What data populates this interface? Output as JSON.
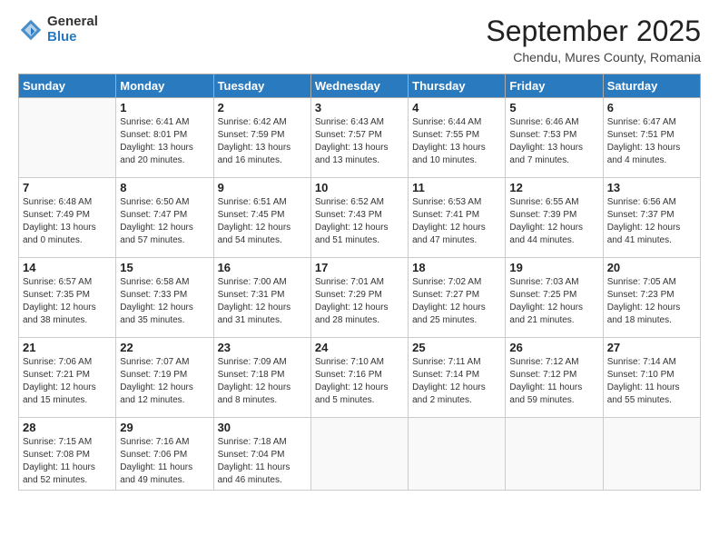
{
  "logo": {
    "general": "General",
    "blue": "Blue"
  },
  "title": "September 2025",
  "location": "Chendu, Mures County, Romania",
  "days_of_week": [
    "Sunday",
    "Monday",
    "Tuesday",
    "Wednesday",
    "Thursday",
    "Friday",
    "Saturday"
  ],
  "weeks": [
    [
      {
        "day": "",
        "info": ""
      },
      {
        "day": "1",
        "info": "Sunrise: 6:41 AM\nSunset: 8:01 PM\nDaylight: 13 hours\nand 20 minutes."
      },
      {
        "day": "2",
        "info": "Sunrise: 6:42 AM\nSunset: 7:59 PM\nDaylight: 13 hours\nand 16 minutes."
      },
      {
        "day": "3",
        "info": "Sunrise: 6:43 AM\nSunset: 7:57 PM\nDaylight: 13 hours\nand 13 minutes."
      },
      {
        "day": "4",
        "info": "Sunrise: 6:44 AM\nSunset: 7:55 PM\nDaylight: 13 hours\nand 10 minutes."
      },
      {
        "day": "5",
        "info": "Sunrise: 6:46 AM\nSunset: 7:53 PM\nDaylight: 13 hours\nand 7 minutes."
      },
      {
        "day": "6",
        "info": "Sunrise: 6:47 AM\nSunset: 7:51 PM\nDaylight: 13 hours\nand 4 minutes."
      }
    ],
    [
      {
        "day": "7",
        "info": "Sunrise: 6:48 AM\nSunset: 7:49 PM\nDaylight: 13 hours\nand 0 minutes."
      },
      {
        "day": "8",
        "info": "Sunrise: 6:50 AM\nSunset: 7:47 PM\nDaylight: 12 hours\nand 57 minutes."
      },
      {
        "day": "9",
        "info": "Sunrise: 6:51 AM\nSunset: 7:45 PM\nDaylight: 12 hours\nand 54 minutes."
      },
      {
        "day": "10",
        "info": "Sunrise: 6:52 AM\nSunset: 7:43 PM\nDaylight: 12 hours\nand 51 minutes."
      },
      {
        "day": "11",
        "info": "Sunrise: 6:53 AM\nSunset: 7:41 PM\nDaylight: 12 hours\nand 47 minutes."
      },
      {
        "day": "12",
        "info": "Sunrise: 6:55 AM\nSunset: 7:39 PM\nDaylight: 12 hours\nand 44 minutes."
      },
      {
        "day": "13",
        "info": "Sunrise: 6:56 AM\nSunset: 7:37 PM\nDaylight: 12 hours\nand 41 minutes."
      }
    ],
    [
      {
        "day": "14",
        "info": "Sunrise: 6:57 AM\nSunset: 7:35 PM\nDaylight: 12 hours\nand 38 minutes."
      },
      {
        "day": "15",
        "info": "Sunrise: 6:58 AM\nSunset: 7:33 PM\nDaylight: 12 hours\nand 35 minutes."
      },
      {
        "day": "16",
        "info": "Sunrise: 7:00 AM\nSunset: 7:31 PM\nDaylight: 12 hours\nand 31 minutes."
      },
      {
        "day": "17",
        "info": "Sunrise: 7:01 AM\nSunset: 7:29 PM\nDaylight: 12 hours\nand 28 minutes."
      },
      {
        "day": "18",
        "info": "Sunrise: 7:02 AM\nSunset: 7:27 PM\nDaylight: 12 hours\nand 25 minutes."
      },
      {
        "day": "19",
        "info": "Sunrise: 7:03 AM\nSunset: 7:25 PM\nDaylight: 12 hours\nand 21 minutes."
      },
      {
        "day": "20",
        "info": "Sunrise: 7:05 AM\nSunset: 7:23 PM\nDaylight: 12 hours\nand 18 minutes."
      }
    ],
    [
      {
        "day": "21",
        "info": "Sunrise: 7:06 AM\nSunset: 7:21 PM\nDaylight: 12 hours\nand 15 minutes."
      },
      {
        "day": "22",
        "info": "Sunrise: 7:07 AM\nSunset: 7:19 PM\nDaylight: 12 hours\nand 12 minutes."
      },
      {
        "day": "23",
        "info": "Sunrise: 7:09 AM\nSunset: 7:18 PM\nDaylight: 12 hours\nand 8 minutes."
      },
      {
        "day": "24",
        "info": "Sunrise: 7:10 AM\nSunset: 7:16 PM\nDaylight: 12 hours\nand 5 minutes."
      },
      {
        "day": "25",
        "info": "Sunrise: 7:11 AM\nSunset: 7:14 PM\nDaylight: 12 hours\nand 2 minutes."
      },
      {
        "day": "26",
        "info": "Sunrise: 7:12 AM\nSunset: 7:12 PM\nDaylight: 11 hours\nand 59 minutes."
      },
      {
        "day": "27",
        "info": "Sunrise: 7:14 AM\nSunset: 7:10 PM\nDaylight: 11 hours\nand 55 minutes."
      }
    ],
    [
      {
        "day": "28",
        "info": "Sunrise: 7:15 AM\nSunset: 7:08 PM\nDaylight: 11 hours\nand 52 minutes."
      },
      {
        "day": "29",
        "info": "Sunrise: 7:16 AM\nSunset: 7:06 PM\nDaylight: 11 hours\nand 49 minutes."
      },
      {
        "day": "30",
        "info": "Sunrise: 7:18 AM\nSunset: 7:04 PM\nDaylight: 11 hours\nand 46 minutes."
      },
      {
        "day": "",
        "info": ""
      },
      {
        "day": "",
        "info": ""
      },
      {
        "day": "",
        "info": ""
      },
      {
        "day": "",
        "info": ""
      }
    ]
  ]
}
